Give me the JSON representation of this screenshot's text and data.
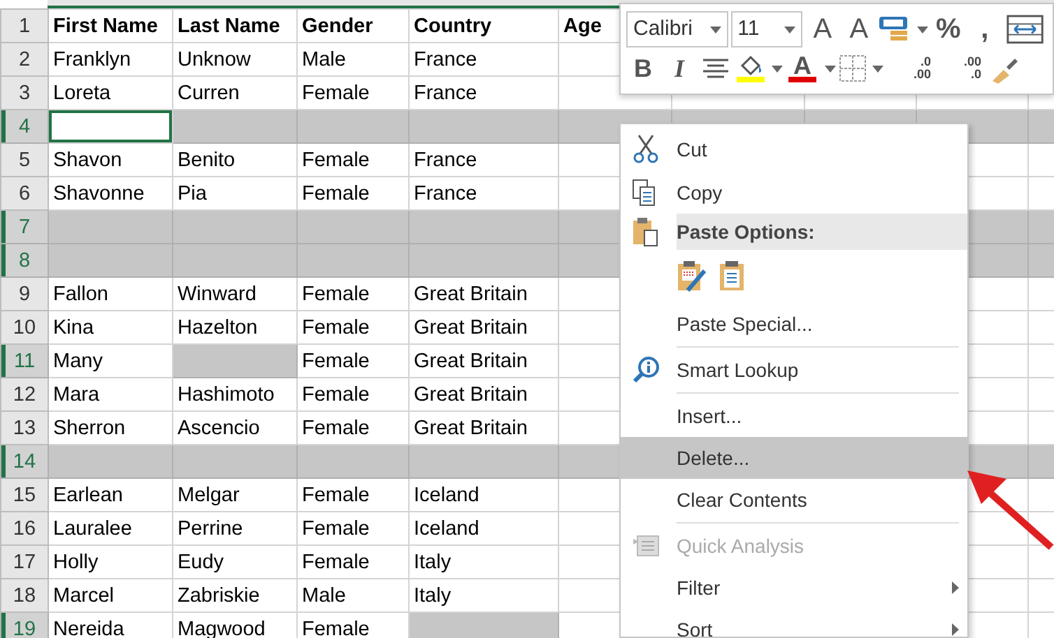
{
  "sheet": {
    "rows": [
      {
        "num": "1",
        "selected": false,
        "kind": "header",
        "cells": [
          {
            "text": "First Name",
            "selected": false,
            "active": false
          },
          {
            "text": "Last Name",
            "selected": false,
            "active": false
          },
          {
            "text": "Gender",
            "selected": false,
            "active": false
          },
          {
            "text": "Country",
            "selected": false,
            "active": false
          },
          {
            "text": "Age",
            "selected": false,
            "active": false
          }
        ]
      },
      {
        "num": "2",
        "selected": false,
        "kind": "data",
        "cells": [
          {
            "text": "Franklyn",
            "selected": false,
            "active": false
          },
          {
            "text": "Unknow",
            "selected": false,
            "active": false
          },
          {
            "text": "Male",
            "selected": false,
            "active": false
          },
          {
            "text": "France",
            "selected": false,
            "active": false
          },
          {
            "selected": false,
            "active": false
          }
        ]
      },
      {
        "num": "3",
        "selected": false,
        "kind": "data",
        "cells": [
          {
            "text": "Loreta",
            "selected": false,
            "active": false
          },
          {
            "text": "Curren",
            "selected": false,
            "active": false
          },
          {
            "text": "Female",
            "selected": false,
            "active": false
          },
          {
            "text": "France",
            "selected": false,
            "active": false
          },
          {
            "selected": false,
            "active": false
          }
        ]
      },
      {
        "num": "4",
        "selected": true,
        "kind": "data",
        "cells": [
          {
            "selected": true,
            "active": true
          },
          {
            "selected": true,
            "active": false
          },
          {
            "selected": true,
            "active": false
          },
          {
            "selected": true,
            "active": false
          },
          {
            "selected": true,
            "active": false
          }
        ]
      },
      {
        "num": "5",
        "selected": false,
        "kind": "data",
        "cells": [
          {
            "text": "Shavon",
            "selected": false,
            "active": false
          },
          {
            "text": "Benito",
            "selected": false,
            "active": false
          },
          {
            "text": "Female",
            "selected": false,
            "active": false
          },
          {
            "text": "France",
            "selected": false,
            "active": false
          },
          {
            "selected": false,
            "active": false
          }
        ]
      },
      {
        "num": "6",
        "selected": false,
        "kind": "data",
        "cells": [
          {
            "text": "Shavonne",
            "selected": false,
            "active": false
          },
          {
            "text": "Pia",
            "selected": false,
            "active": false
          },
          {
            "text": "Female",
            "selected": false,
            "active": false
          },
          {
            "text": "France",
            "selected": false,
            "active": false
          },
          {
            "selected": false,
            "active": false
          }
        ]
      },
      {
        "num": "7",
        "selected": true,
        "kind": "data",
        "cells": [
          {
            "selected": true,
            "active": false
          },
          {
            "selected": true,
            "active": false
          },
          {
            "selected": true,
            "active": false
          },
          {
            "selected": true,
            "active": false
          },
          {
            "selected": true,
            "active": false
          }
        ]
      },
      {
        "num": "8",
        "selected": true,
        "kind": "data",
        "cells": [
          {
            "selected": true,
            "active": false
          },
          {
            "selected": true,
            "active": false
          },
          {
            "selected": true,
            "active": false
          },
          {
            "selected": true,
            "active": false
          },
          {
            "selected": true,
            "active": false
          }
        ]
      },
      {
        "num": "9",
        "selected": false,
        "kind": "data",
        "cells": [
          {
            "text": "Fallon",
            "selected": false,
            "active": false
          },
          {
            "text": "Winward",
            "selected": false,
            "active": false
          },
          {
            "text": "Female",
            "selected": false,
            "active": false
          },
          {
            "text": "Great Britain",
            "selected": false,
            "active": false
          },
          {
            "selected": false,
            "active": false
          }
        ]
      },
      {
        "num": "10",
        "selected": false,
        "kind": "data",
        "cells": [
          {
            "text": "Kina",
            "selected": false,
            "active": false
          },
          {
            "text": "Hazelton",
            "selected": false,
            "active": false
          },
          {
            "text": "Female",
            "selected": false,
            "active": false
          },
          {
            "text": "Great Britain",
            "selected": false,
            "active": false
          },
          {
            "selected": false,
            "active": false
          }
        ]
      },
      {
        "num": "11",
        "selected": true,
        "kind": "data",
        "cells": [
          {
            "text": "Many",
            "selected": false,
            "active": false
          },
          {
            "selected": true,
            "active": false
          },
          {
            "text": "Female",
            "selected": false,
            "active": false
          },
          {
            "text": "Great Britain",
            "selected": false,
            "active": false
          },
          {
            "selected": false,
            "active": false
          }
        ]
      },
      {
        "num": "12",
        "selected": false,
        "kind": "data",
        "cells": [
          {
            "text": "Mara",
            "selected": false,
            "active": false
          },
          {
            "text": "Hashimoto",
            "selected": false,
            "active": false
          },
          {
            "text": "Female",
            "selected": false,
            "active": false
          },
          {
            "text": "Great Britain",
            "selected": false,
            "active": false
          },
          {
            "selected": false,
            "active": false
          }
        ]
      },
      {
        "num": "13",
        "selected": false,
        "kind": "data",
        "cells": [
          {
            "text": "Sherron",
            "selected": false,
            "active": false
          },
          {
            "text": "Ascencio",
            "selected": false,
            "active": false
          },
          {
            "text": "Female",
            "selected": false,
            "active": false
          },
          {
            "text": "Great Britain",
            "selected": false,
            "active": false
          },
          {
            "selected": false,
            "active": false
          }
        ]
      },
      {
        "num": "14",
        "selected": true,
        "kind": "data",
        "cells": [
          {
            "selected": true,
            "active": false
          },
          {
            "selected": true,
            "active": false
          },
          {
            "selected": true,
            "active": false
          },
          {
            "selected": true,
            "active": false
          },
          {
            "selected": true,
            "active": false
          }
        ]
      },
      {
        "num": "15",
        "selected": false,
        "kind": "data",
        "cells": [
          {
            "text": "Earlean",
            "selected": false,
            "active": false
          },
          {
            "text": "Melgar",
            "selected": false,
            "active": false
          },
          {
            "text": "Female",
            "selected": false,
            "active": false
          },
          {
            "text": "Iceland",
            "selected": false,
            "active": false
          },
          {
            "selected": false,
            "active": false
          }
        ]
      },
      {
        "num": "16",
        "selected": false,
        "kind": "data",
        "cells": [
          {
            "text": "Lauralee",
            "selected": false,
            "active": false
          },
          {
            "text": "Perrine",
            "selected": false,
            "active": false
          },
          {
            "text": "Female",
            "selected": false,
            "active": false
          },
          {
            "text": "Iceland",
            "selected": false,
            "active": false
          },
          {
            "selected": false,
            "active": false
          }
        ]
      },
      {
        "num": "17",
        "selected": false,
        "kind": "data",
        "cells": [
          {
            "text": "Holly",
            "selected": false,
            "active": false
          },
          {
            "text": "Eudy",
            "selected": false,
            "active": false
          },
          {
            "text": "Female",
            "selected": false,
            "active": false
          },
          {
            "text": "Italy",
            "selected": false,
            "active": false
          },
          {
            "selected": false,
            "active": false
          }
        ]
      },
      {
        "num": "18",
        "selected": false,
        "kind": "data",
        "cells": [
          {
            "text": "Marcel",
            "selected": false,
            "active": false
          },
          {
            "text": "Zabriskie",
            "selected": false,
            "active": false
          },
          {
            "text": "Male",
            "selected": false,
            "active": false
          },
          {
            "text": "Italy",
            "selected": false,
            "active": false
          },
          {
            "selected": false,
            "active": false
          }
        ]
      },
      {
        "num": "19",
        "selected": true,
        "kind": "data",
        "cells": [
          {
            "text": "Nereida",
            "selected": false,
            "active": false
          },
          {
            "text": "Magwood",
            "selected": false,
            "active": false
          },
          {
            "text": "Female",
            "selected": false,
            "active": false
          },
          {
            "selected": true,
            "active": false
          },
          {
            "selected": false,
            "active": false
          }
        ]
      }
    ]
  },
  "mini_toolbar": {
    "font": "Calibri",
    "size": "11",
    "row1": [
      {
        "kind": "grow",
        "label": "A"
      },
      {
        "kind": "shrink",
        "label": "A"
      },
      {
        "kind": "format"
      },
      {
        "kind": "text",
        "label": "%"
      },
      {
        "kind": "text",
        "label": ","
      },
      {
        "kind": "wrap"
      }
    ],
    "row2": [
      {
        "kind": "bold",
        "label": "B"
      },
      {
        "kind": "italic",
        "label": "I"
      },
      {
        "kind": "align"
      },
      {
        "kind": "fill"
      },
      {
        "kind": "fontcolor",
        "label": "A"
      },
      {
        "kind": "borders"
      },
      {
        "kind": "inc_decimal",
        "top": ".0",
        "bottom": ".00"
      },
      {
        "kind": "dec_decimal",
        "top": ".00",
        "bottom": ".0"
      },
      {
        "kind": "painter"
      }
    ]
  },
  "context_menu": [
    {
      "kind": "item",
      "label": "Cut",
      "disabled": false,
      "highlighted": false,
      "submenu": false
    },
    {
      "kind": "item",
      "label": "Copy",
      "disabled": false,
      "highlighted": false,
      "submenu": false
    },
    {
      "kind": "header",
      "label": "Paste Options:"
    },
    {
      "kind": "paste_icons"
    },
    {
      "kind": "item",
      "label": "Paste Special...",
      "disabled": false,
      "highlighted": false,
      "submenu": false
    },
    {
      "kind": "separator"
    },
    {
      "kind": "item",
      "label": "Smart Lookup",
      "disabled": false,
      "highlighted": false,
      "submenu": false
    },
    {
      "kind": "separator"
    },
    {
      "kind": "item",
      "label": "Insert...",
      "disabled": false,
      "highlighted": false,
      "submenu": false
    },
    {
      "kind": "item",
      "label": "Delete...",
      "disabled": false,
      "highlighted": true,
      "submenu": false
    },
    {
      "kind": "item",
      "label": "Clear Contents",
      "disabled": false,
      "highlighted": false,
      "submenu": false
    },
    {
      "kind": "separator"
    },
    {
      "kind": "item",
      "label": "Quick Analysis",
      "disabled": true,
      "highlighted": false,
      "submenu": false
    },
    {
      "kind": "item",
      "label": "Filter",
      "disabled": false,
      "highlighted": false,
      "submenu": true
    },
    {
      "kind": "item",
      "label": "Sort",
      "disabled": false,
      "highlighted": false,
      "submenu": true
    }
  ]
}
